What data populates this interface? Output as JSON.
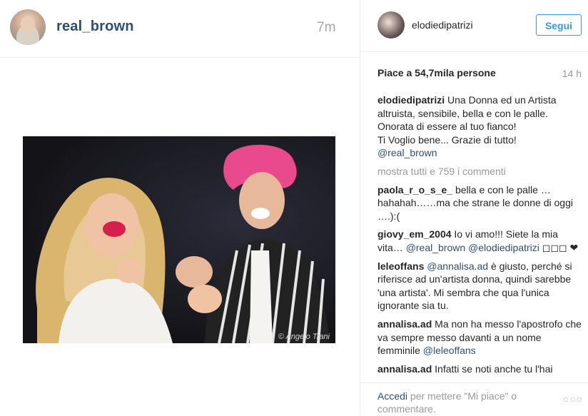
{
  "post": {
    "author": "real_brown",
    "time": "7m",
    "photo_credit": "© Angelo Trani"
  },
  "sidebar": {
    "author": "elodiedipatrizi",
    "follow_label": "Segui",
    "likes": "Piace a 54,7mila persone",
    "time": "14 h",
    "caption_author": "elodiedipatrizi",
    "caption_lines": [
      "Una Donna ed un Artista",
      "altruista, sensibile, bella e con le palle.",
      "Onorata di essere al tuo fianco!",
      "Ti Voglio bene... Grazie di tutto!"
    ],
    "caption_mention": "@real_brown",
    "show_all": "mostra tutti e 759 i commenti",
    "comments": [
      {
        "author": "paola_r_o_s_e_",
        "text": "bella e con le palle …hahahah……ma che strane le donne di oggi ….):(",
        "mentions": []
      },
      {
        "author": "giovy_em_2004",
        "text": "Io vi amo!!! Siete la mia vita…",
        "mentions": [
          "@real_brown",
          "@elodiedipatrizi"
        ],
        "suffix": "◻◻◻ ❤"
      },
      {
        "author": "leleoffans",
        "prefix_mention": "@annalisa.ad",
        "text": "è giusto, perché si riferisce ad un'artista donna, quindi sarebbe 'una artista'. Mi sembra che qua l'unica ignorante sia tu.",
        "mentions": []
      },
      {
        "author": "annalisa.ad",
        "text": "Ma non ha messo l'apostrofo che va sempre messo davanti a un nome femminile",
        "mentions": [
          "@leleoffans"
        ]
      },
      {
        "author": "annalisa.ad",
        "text": "Infatti se noti anche tu l'hai",
        "mentions": []
      }
    ],
    "login_link": "Accedi",
    "login_text": "per mettere \"Mi piace\" o commentare.",
    "more_label": "○○○"
  },
  "colors": {
    "link": "#2f4f6f",
    "accent": "#3897f0",
    "muted": "#999999"
  }
}
